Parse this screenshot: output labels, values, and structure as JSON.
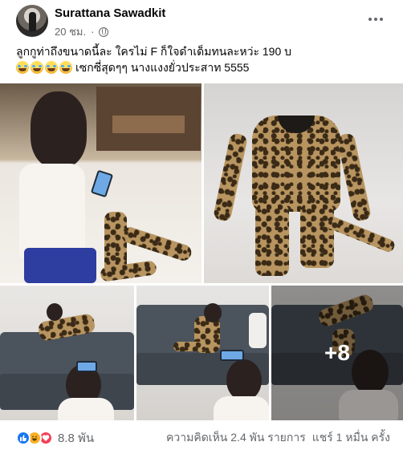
{
  "post": {
    "author": "Surattana Sawadkit",
    "time": "20 ชม.",
    "privacy_icon": "globe-icon",
    "more_icon": "more-options-icon",
    "text_line1": "ลูกกูท่าถึงขนาดนี้ละ ใครไม่ F ก็ใจดำเด็มทนละหว่ะ 190 บ",
    "text_line2": "เซกซี่สุดๆๆ นางแงงยั่วประสาท 5555",
    "emoji_count": 4
  },
  "photos": [
    {
      "name": "photo-child-with-costume-floor"
    },
    {
      "name": "photo-leopard-costume"
    },
    {
      "name": "photo-child-on-sofa-1"
    },
    {
      "name": "photo-child-on-sofa-2"
    },
    {
      "name": "photo-child-on-sofa-3"
    }
  ],
  "more_photos": "+8",
  "footer": {
    "reaction_icons": [
      "like-icon",
      "haha-icon",
      "love-icon"
    ],
    "reaction_count": "8.8 พัน",
    "comments": "ความคิดเห็น 2.4 พัน รายการ",
    "shares": "แชร์ 1 หมื่น ครั้ง"
  },
  "colors": {
    "like": "#1877f2",
    "haha": "#f7b125",
    "love": "#f33e58",
    "secondary_text": "#65676b"
  }
}
